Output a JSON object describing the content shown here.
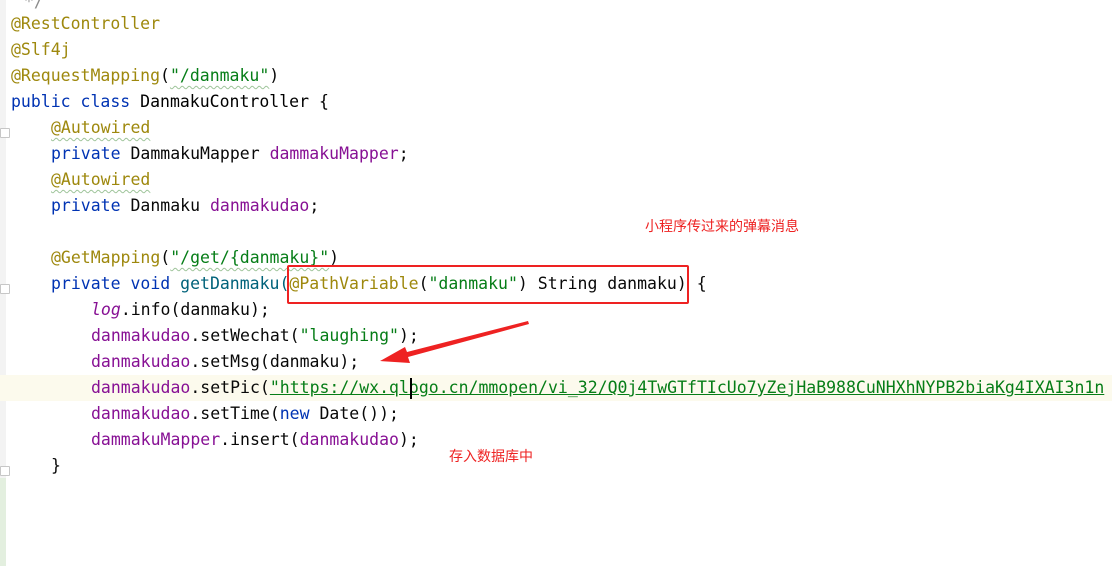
{
  "code": {
    "line0": "*/",
    "line1": "@RestController",
    "line2": "@Slf4j",
    "line3_ann": "@RequestMapping",
    "line3_str": "\"/danmaku\"",
    "line4_kw": "public class ",
    "line4_rest": "DanmakuController {",
    "line5": "@Autowired",
    "line6_kw": "private ",
    "line6_type": "DammakuMapper ",
    "line6_field": "dammakuMapper",
    "line7": "@Autowired",
    "line8_kw": "private ",
    "line8_type": "Danmaku ",
    "line8_field": "danmakudao",
    "line9_ann": "@GetMapping",
    "line9_str": "\"/get/{danmaku}\"",
    "line10_kw": "private void ",
    "line10_method": "getDanmaku(",
    "line10_ann": "@PathVariable",
    "line10_str": "\"danmaku\"",
    "line10_rest": ") String danmaku) {",
    "line11_static": "log",
    "line11_rest": ".info(danmaku);",
    "line12_field": "danmakudao",
    "line12_call": ".setWechat(",
    "line12_str": "\"laughing\"",
    "line12_end": ");",
    "line13_field": "danmakudao",
    "line13_call": ".setMsg(danmaku);",
    "line14_field": "danmakudao",
    "line14_call": ".setPic(",
    "line14_str": "\"https://wx.qlogo.cn/mmopen/vi_32/Q0j4TwGTfTIcUo7yZejHaB988CuNHXhNYPB2biaKg4IXAI3n1n",
    "line15_field": "danmakudao",
    "line15_call": ".setTime(",
    "line15_kw": "new ",
    "line15_end": "Date());",
    "line16_field": "dammakuMapper",
    "line16_call": ".insert(",
    "line16_arg": "danmakudao",
    "line16_end": ");",
    "line17": "}"
  },
  "annotations": {
    "top_note": "小程序传过来的弹幕消息",
    "bottom_note": "存入数据库中",
    "color": "#ee2222"
  }
}
